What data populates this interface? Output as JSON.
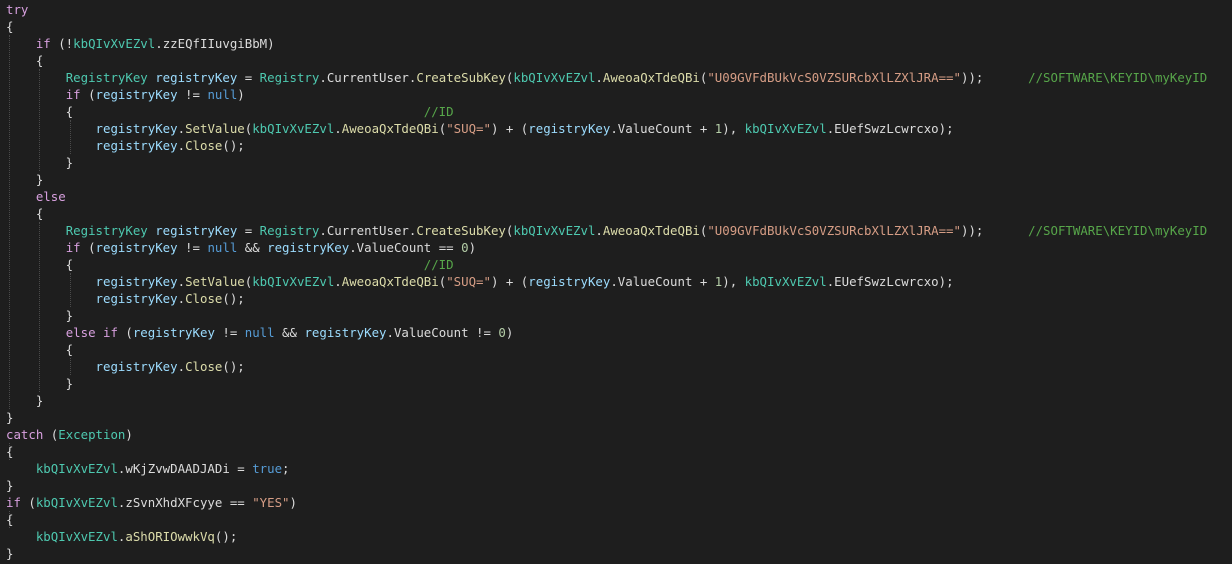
{
  "colors": {
    "background": "#1e1e1e",
    "plain": "#dcdcdc",
    "control_keyword": "#d8a0df",
    "keyword": "#569cd6",
    "type": "#4ec9b0",
    "variable": "#9cdcfe",
    "method": "#dcdcaa",
    "string": "#d69d85",
    "comment": "#57a64a",
    "number": "#b5cea8",
    "indent_guide": "#4a4a4a"
  },
  "code": {
    "lines": [
      [
        [
          "kw",
          "try"
        ]
      ],
      [
        [
          "plain",
          "{"
        ]
      ],
      [
        [
          "plain",
          "    "
        ],
        [
          "kw",
          "if"
        ],
        [
          "plain",
          " (!"
        ],
        [
          "type",
          "kbQIvXvEZvl"
        ],
        [
          "plain",
          "."
        ],
        [
          "plain",
          "zzEQfIIuvgiBbM"
        ],
        [
          "plain",
          ")"
        ]
      ],
      [
        [
          "plain",
          "    {"
        ]
      ],
      [
        [
          "plain",
          "        "
        ],
        [
          "type",
          "RegistryKey"
        ],
        [
          "plain",
          " "
        ],
        [
          "var",
          "registryKey"
        ],
        [
          "plain",
          " = "
        ],
        [
          "type",
          "Registry"
        ],
        [
          "plain",
          "."
        ],
        [
          "plain",
          "CurrentUser"
        ],
        [
          "plain",
          "."
        ],
        [
          "method",
          "CreateSubKey"
        ],
        [
          "plain",
          "("
        ],
        [
          "type",
          "kbQIvXvEZvl"
        ],
        [
          "plain",
          "."
        ],
        [
          "method",
          "AweoaQxTdeQBi"
        ],
        [
          "plain",
          "("
        ],
        [
          "str",
          "\"U09GVFdBUkVcS0VZSURcbXlLZXlJRA==\""
        ],
        [
          "plain",
          "));      "
        ],
        [
          "comment",
          "//SOFTWARE\\KEYID\\myKeyID"
        ]
      ],
      [
        [
          "plain",
          "        "
        ],
        [
          "kw",
          "if"
        ],
        [
          "plain",
          " ("
        ],
        [
          "var",
          "registryKey"
        ],
        [
          "plain",
          " != "
        ],
        [
          "kwb",
          "null"
        ],
        [
          "plain",
          ")"
        ]
      ],
      [
        [
          "plain",
          "        {                                               "
        ],
        [
          "comment",
          "//ID"
        ]
      ],
      [
        [
          "plain",
          "            "
        ],
        [
          "var",
          "registryKey"
        ],
        [
          "plain",
          "."
        ],
        [
          "method",
          "SetValue"
        ],
        [
          "plain",
          "("
        ],
        [
          "type",
          "kbQIvXvEZvl"
        ],
        [
          "plain",
          "."
        ],
        [
          "method",
          "AweoaQxTdeQBi"
        ],
        [
          "plain",
          "("
        ],
        [
          "str",
          "\"SUQ=\""
        ],
        [
          "plain",
          ") + ("
        ],
        [
          "var",
          "registryKey"
        ],
        [
          "plain",
          ".ValueCount + "
        ],
        [
          "num",
          "1"
        ],
        [
          "plain",
          "), "
        ],
        [
          "type",
          "kbQIvXvEZvl"
        ],
        [
          "plain",
          "."
        ],
        [
          "plain",
          "EUefSwzLcwrcxo"
        ],
        [
          "plain",
          ");"
        ]
      ],
      [
        [
          "plain",
          "            "
        ],
        [
          "var",
          "registryKey"
        ],
        [
          "plain",
          "."
        ],
        [
          "method",
          "Close"
        ],
        [
          "plain",
          "();"
        ]
      ],
      [
        [
          "plain",
          "        }"
        ]
      ],
      [
        [
          "plain",
          "    }"
        ]
      ],
      [
        [
          "plain",
          "    "
        ],
        [
          "kw",
          "else"
        ]
      ],
      [
        [
          "plain",
          "    {"
        ]
      ],
      [
        [
          "plain",
          "        "
        ],
        [
          "type",
          "RegistryKey"
        ],
        [
          "plain",
          " "
        ],
        [
          "var",
          "registryKey"
        ],
        [
          "plain",
          " = "
        ],
        [
          "type",
          "Registry"
        ],
        [
          "plain",
          "."
        ],
        [
          "plain",
          "CurrentUser"
        ],
        [
          "plain",
          "."
        ],
        [
          "method",
          "CreateSubKey"
        ],
        [
          "plain",
          "("
        ],
        [
          "type",
          "kbQIvXvEZvl"
        ],
        [
          "plain",
          "."
        ],
        [
          "method",
          "AweoaQxTdeQBi"
        ],
        [
          "plain",
          "("
        ],
        [
          "str",
          "\"U09GVFdBUkVcS0VZSURcbXlLZXlJRA==\""
        ],
        [
          "plain",
          "));      "
        ],
        [
          "comment",
          "//SOFTWARE\\KEYID\\myKeyID"
        ]
      ],
      [
        [
          "plain",
          "        "
        ],
        [
          "kw",
          "if"
        ],
        [
          "plain",
          " ("
        ],
        [
          "var",
          "registryKey"
        ],
        [
          "plain",
          " != "
        ],
        [
          "kwb",
          "null"
        ],
        [
          "plain",
          " && "
        ],
        [
          "var",
          "registryKey"
        ],
        [
          "plain",
          ".ValueCount == "
        ],
        [
          "num",
          "0"
        ],
        [
          "plain",
          ")"
        ]
      ],
      [
        [
          "plain",
          "        {                                               "
        ],
        [
          "comment",
          "//ID"
        ]
      ],
      [
        [
          "plain",
          "            "
        ],
        [
          "var",
          "registryKey"
        ],
        [
          "plain",
          "."
        ],
        [
          "method",
          "SetValue"
        ],
        [
          "plain",
          "("
        ],
        [
          "type",
          "kbQIvXvEZvl"
        ],
        [
          "plain",
          "."
        ],
        [
          "method",
          "AweoaQxTdeQBi"
        ],
        [
          "plain",
          "("
        ],
        [
          "str",
          "\"SUQ=\""
        ],
        [
          "plain",
          ") + ("
        ],
        [
          "var",
          "registryKey"
        ],
        [
          "plain",
          ".ValueCount + "
        ],
        [
          "num",
          "1"
        ],
        [
          "plain",
          "), "
        ],
        [
          "type",
          "kbQIvXvEZvl"
        ],
        [
          "plain",
          "."
        ],
        [
          "plain",
          "EUefSwzLcwrcxo"
        ],
        [
          "plain",
          ");"
        ]
      ],
      [
        [
          "plain",
          "            "
        ],
        [
          "var",
          "registryKey"
        ],
        [
          "plain",
          "."
        ],
        [
          "method",
          "Close"
        ],
        [
          "plain",
          "();"
        ]
      ],
      [
        [
          "plain",
          "        }"
        ]
      ],
      [
        [
          "plain",
          "        "
        ],
        [
          "kw",
          "else"
        ],
        [
          "plain",
          " "
        ],
        [
          "kw",
          "if"
        ],
        [
          "plain",
          " ("
        ],
        [
          "var",
          "registryKey"
        ],
        [
          "plain",
          " != "
        ],
        [
          "kwb",
          "null"
        ],
        [
          "plain",
          " && "
        ],
        [
          "var",
          "registryKey"
        ],
        [
          "plain",
          ".ValueCount != "
        ],
        [
          "num",
          "0"
        ],
        [
          "plain",
          ")"
        ]
      ],
      [
        [
          "plain",
          "        {"
        ]
      ],
      [
        [
          "plain",
          "            "
        ],
        [
          "var",
          "registryKey"
        ],
        [
          "plain",
          "."
        ],
        [
          "method",
          "Close"
        ],
        [
          "plain",
          "();"
        ]
      ],
      [
        [
          "plain",
          "        }"
        ]
      ],
      [
        [
          "plain",
          "    }"
        ]
      ],
      [
        [
          "plain",
          "}"
        ]
      ],
      [
        [
          "kw",
          "catch"
        ],
        [
          "plain",
          " ("
        ],
        [
          "type",
          "Exception"
        ],
        [
          "plain",
          ")"
        ]
      ],
      [
        [
          "plain",
          "{"
        ]
      ],
      [
        [
          "plain",
          "    "
        ],
        [
          "type",
          "kbQIvXvEZvl"
        ],
        [
          "plain",
          "."
        ],
        [
          "plain",
          "wKjZvwDAADJADi"
        ],
        [
          "plain",
          " = "
        ],
        [
          "kwb",
          "true"
        ],
        [
          "plain",
          ";"
        ]
      ],
      [
        [
          "plain",
          "}"
        ]
      ],
      [
        [
          "kw",
          "if"
        ],
        [
          "plain",
          " ("
        ],
        [
          "type",
          "kbQIvXvEZvl"
        ],
        [
          "plain",
          "."
        ],
        [
          "plain",
          "zSvnXhdXFcyye"
        ],
        [
          "plain",
          " == "
        ],
        [
          "str",
          "\"YES\""
        ],
        [
          "plain",
          ")"
        ]
      ],
      [
        [
          "plain",
          "{"
        ]
      ],
      [
        [
          "plain",
          "    "
        ],
        [
          "type",
          "kbQIvXvEZvl"
        ],
        [
          "plain",
          "."
        ],
        [
          "method",
          "aShORIOwwkVq"
        ],
        [
          "plain",
          "();"
        ]
      ],
      [
        [
          "plain",
          "}"
        ]
      ]
    ]
  }
}
